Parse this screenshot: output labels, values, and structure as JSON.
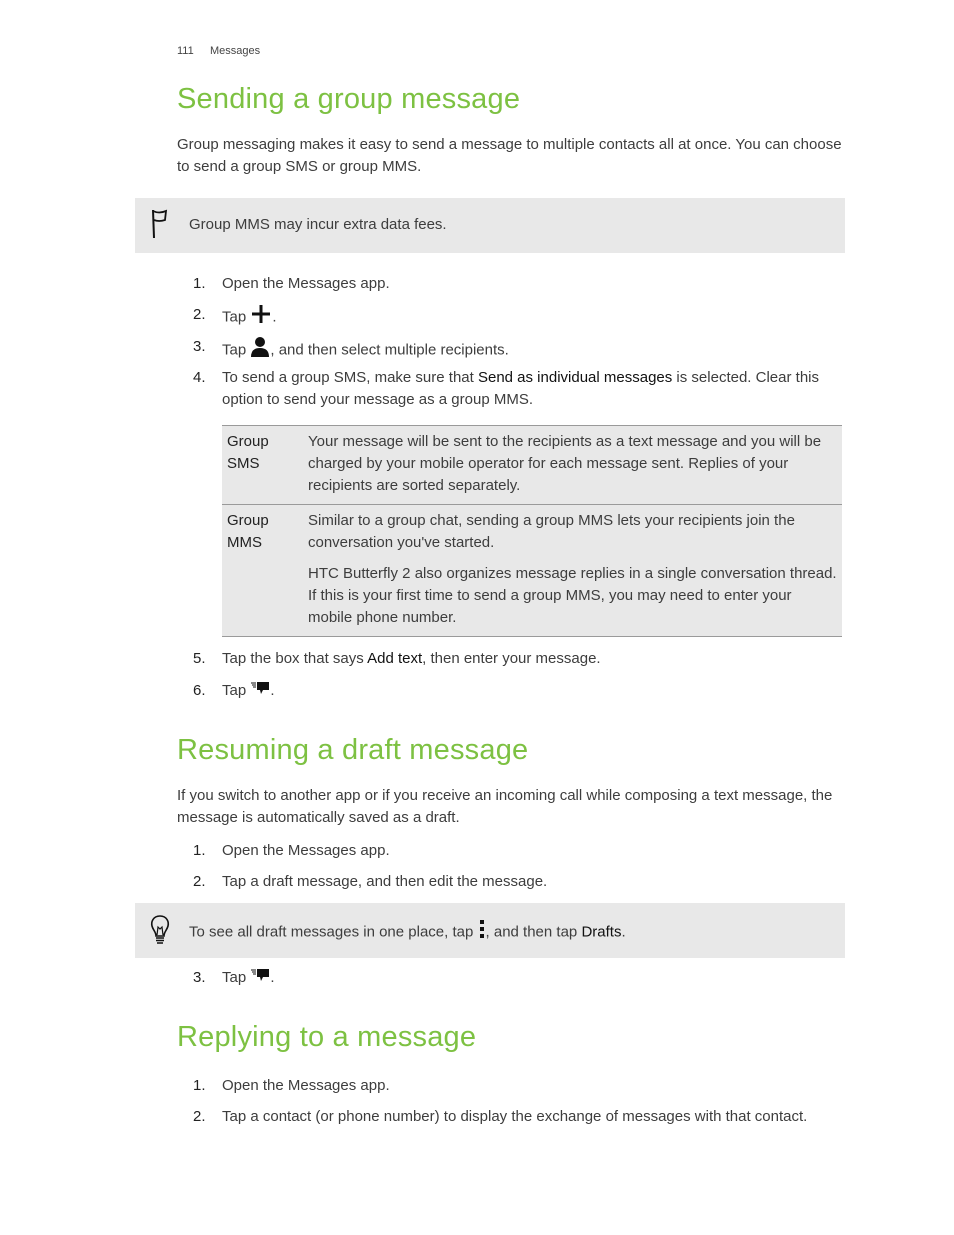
{
  "header": {
    "page_number": "111",
    "section": "Messages"
  },
  "sections": [
    {
      "title": "Sending a group message",
      "intro": "Group messaging makes it easy to send a message to multiple contacts all at once. You can choose to send a group SMS or group MMS.",
      "note": {
        "icon": "flag-icon",
        "text": "Group MMS may incur extra data fees."
      },
      "steps": [
        {
          "num": "1.",
          "text": "Open the Messages app."
        },
        {
          "num": "2.",
          "pre": "Tap ",
          "icon": "plus-icon",
          "post": "."
        },
        {
          "num": "3.",
          "pre": "Tap ",
          "icon": "person-icon",
          "post": ", and then select multiple recipients."
        },
        {
          "num": "4.",
          "pre": "To send a group SMS, make sure that ",
          "strong": "Send as individual messages",
          "post": " is selected. Clear this option to send your message as a group MMS."
        },
        {
          "num": "5.",
          "pre": "Tap the box that says ",
          "strong": "Add text",
          "post": ", then enter your message."
        },
        {
          "num": "6.",
          "pre": "Tap ",
          "icon": "send-icon",
          "post": "."
        }
      ],
      "options_table": [
        {
          "key": "Group SMS",
          "paragraphs": [
            "Your message will be sent to the recipients as a text message and you will be charged by your mobile operator for each message sent. Replies of your recipients are sorted separately."
          ]
        },
        {
          "key": "Group MMS",
          "paragraphs": [
            "Similar to a group chat, sending a group MMS lets your recipients join the conversation you've started.",
            "HTC Butterfly 2 also organizes message replies in a single conversation thread. If this is your first time to send a group MMS, you may need to enter your mobile phone number."
          ]
        }
      ]
    },
    {
      "title": "Resuming a draft message",
      "intro": "If you switch to another app or if you receive an incoming call while composing a text message, the message is automatically saved as a draft.",
      "steps": [
        {
          "num": "1.",
          "text": "Open the Messages app."
        },
        {
          "num": "2.",
          "text": "Tap a draft message, and then edit the message."
        },
        {
          "num": "3.",
          "pre": "Tap ",
          "icon": "send-icon",
          "post": "."
        }
      ],
      "tip": {
        "icon": "lightbulb-icon",
        "pre": "To see all draft messages in one place, tap ",
        "icon_inline": "overflow-menu-icon",
        "mid": ", and then tap ",
        "strong": "Drafts",
        "post": "."
      }
    },
    {
      "title": "Replying to a message",
      "steps": [
        {
          "num": "1.",
          "text": "Open the Messages app."
        },
        {
          "num": "2.",
          "text": "Tap a contact (or phone number) to display the exchange of messages with that contact."
        }
      ]
    }
  ],
  "colors": {
    "heading": "#7dc142",
    "note_bg": "#e8e8e8",
    "text": "#3d3d3d"
  }
}
